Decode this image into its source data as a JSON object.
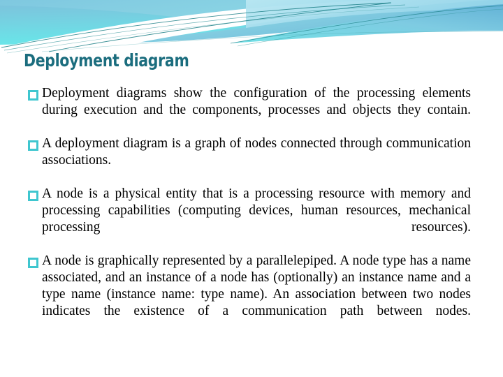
{
  "slide": {
    "title": "Deployment diagram",
    "background_color": "#ffffff",
    "title_color": "#1b6d7e",
    "bullet_marker_color": "#3fc6cf",
    "body_text_color": "#000000",
    "banner": {
      "icon": "wave-swoosh-decoration",
      "colors": {
        "blue_top_left": "#79c6dd",
        "cyan_bright": "#6fe3e8",
        "cyan_mid": "#8fd9e6",
        "blue_right": "#6fb9d8",
        "teal_line": "#1c7f86",
        "white": "#ffffff"
      }
    },
    "bullets": [
      {
        "marker": "hollow-square",
        "text": "Deployment diagrams show the configuration of the processing elements during execution and the components, processes and objects they contain."
      },
      {
        "marker": "hollow-square",
        "text": "A deployment diagram is a graph of nodes connected through communication associations."
      },
      {
        "marker": "hollow-square",
        "text": "A node is a physical entity that is a processing resource with memory and processing capabilities (computing devices, human resources, mechanical processing resources)."
      },
      {
        "marker": "hollow-square",
        "text": "A node is graphically represented by a parallelepiped. A node type has a name associated, and an instance of a node has (optionally) an instance name and a type name (instance name: type name). An association between two nodes indicates the existence of a communication path between nodes."
      }
    ]
  }
}
